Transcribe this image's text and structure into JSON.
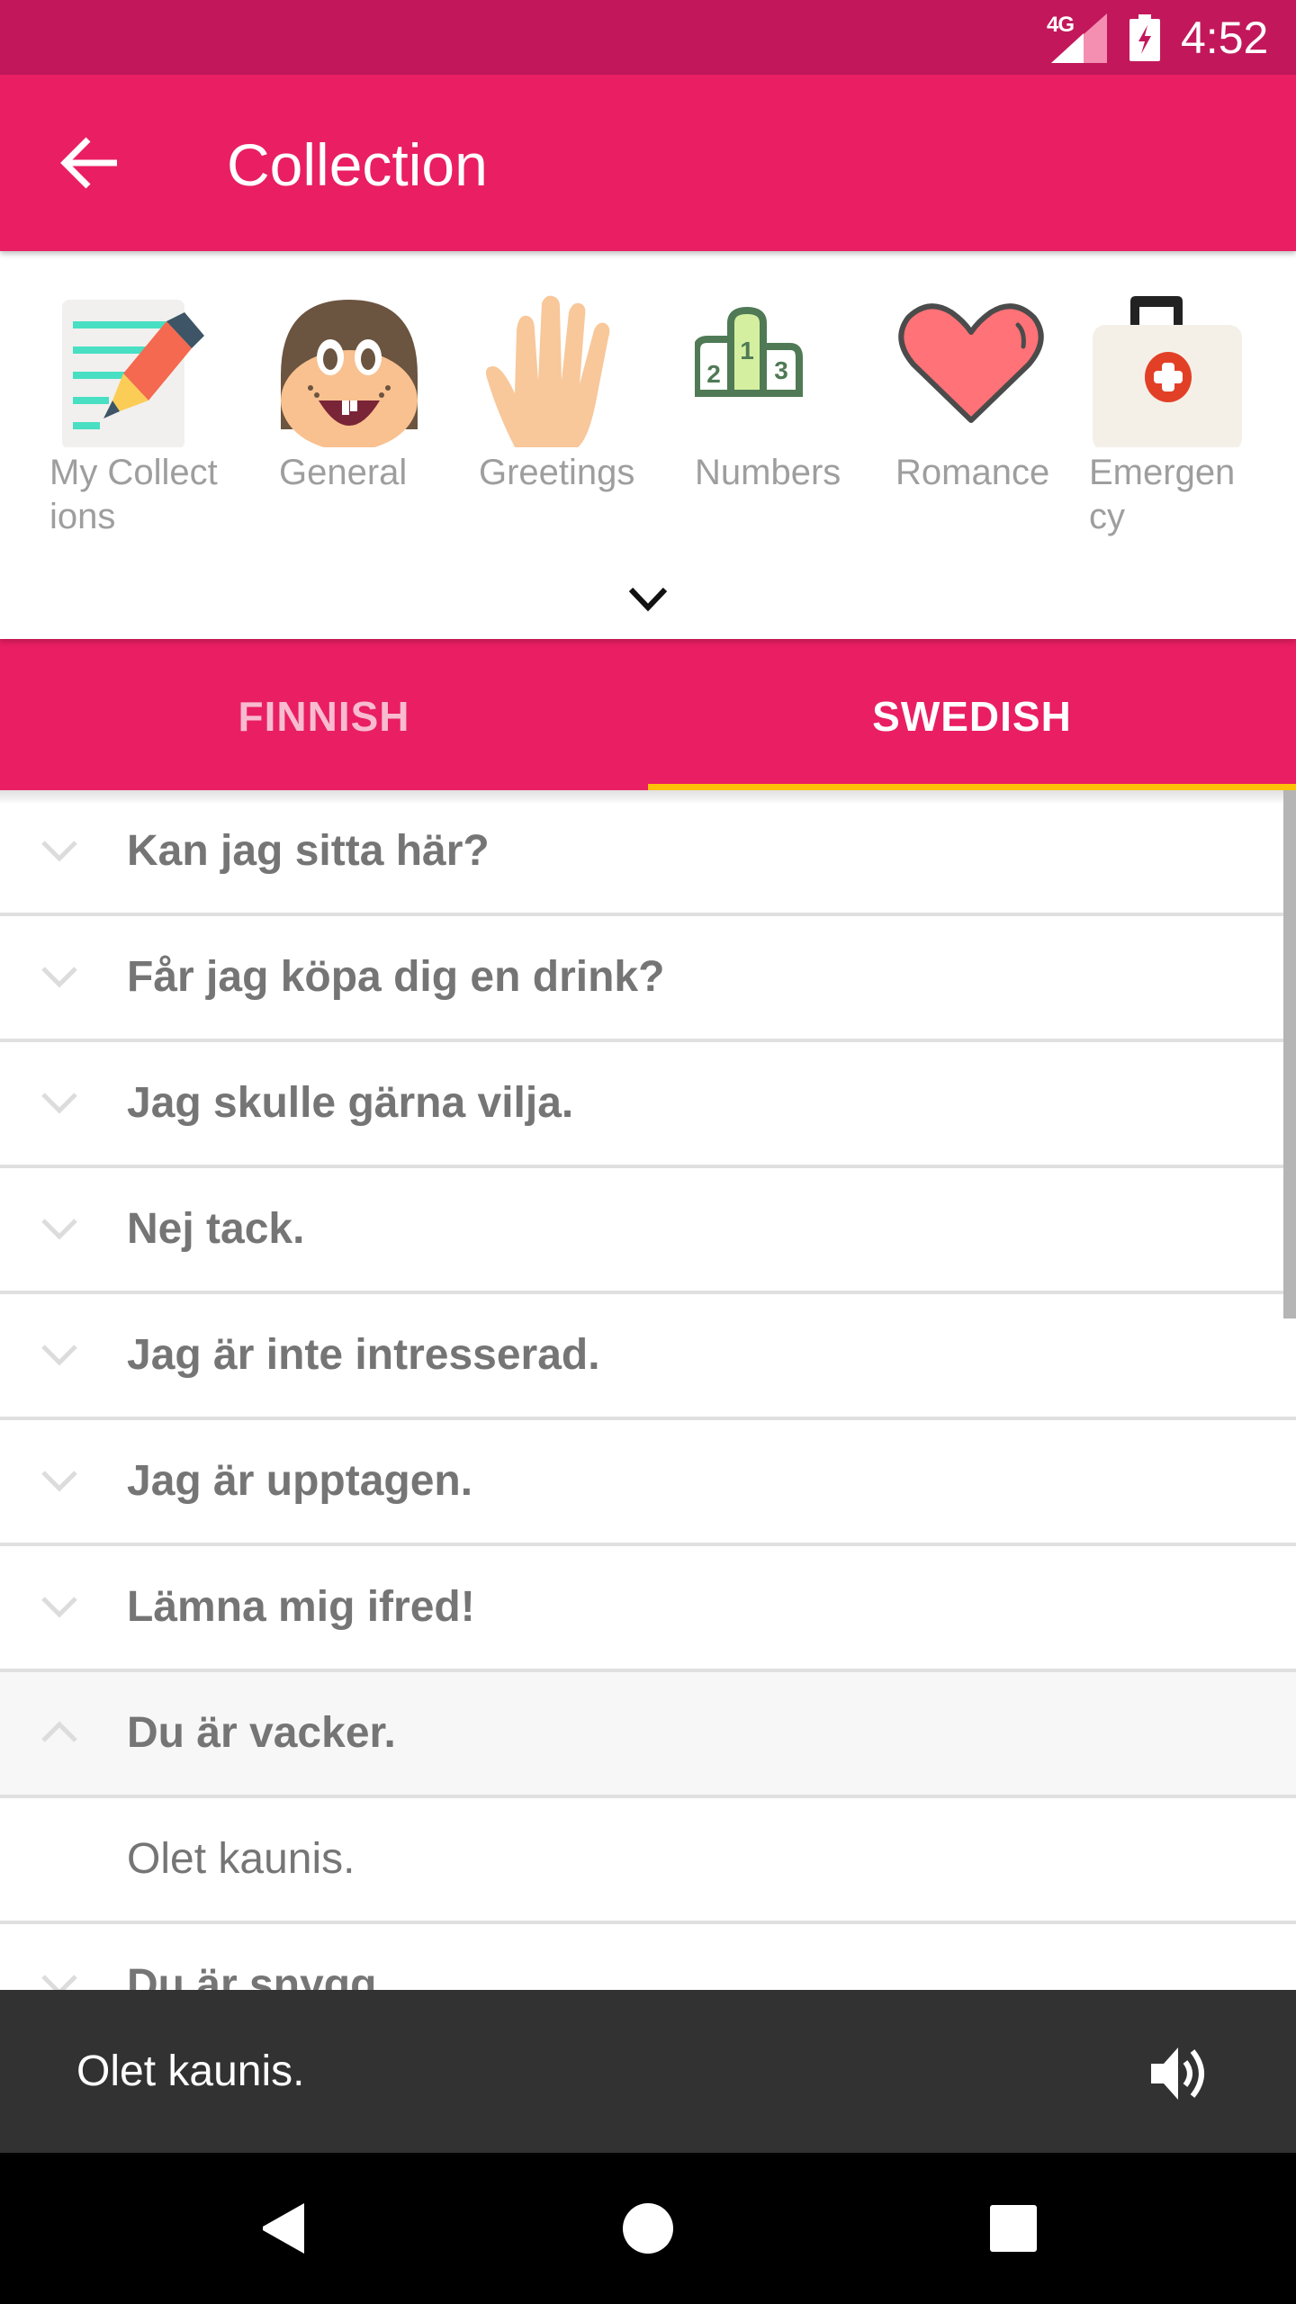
{
  "status_bar": {
    "network": "4G",
    "time": "4:52",
    "icons": [
      "signal-icon",
      "battery-charging-icon"
    ]
  },
  "app_bar": {
    "title": "Collection",
    "back_icon": "arrow-back-icon"
  },
  "categories": {
    "items": [
      {
        "label": "My Collect\nions",
        "icon": "notes-pencil-icon"
      },
      {
        "label": "General",
        "icon": "smiling-face-icon"
      },
      {
        "label": "Greetings",
        "icon": "waving-hand-icon"
      },
      {
        "label": "Numbers",
        "icon": "podium-icon"
      },
      {
        "label": "Romance",
        "icon": "heart-icon"
      },
      {
        "label": "Emergen\ncy",
        "icon": "first-aid-kit-icon"
      }
    ],
    "expand_icon": "chevron-down-icon"
  },
  "tabs": {
    "items": [
      {
        "label": "FINNISH",
        "selected": false
      },
      {
        "label": "SWEDISH",
        "selected": true
      }
    ]
  },
  "colors": {
    "primary": "#e91e63",
    "primary_dark": "#c2185b",
    "accent": "#ffc107",
    "text_secondary": "#757575",
    "snackbar": "#323232"
  },
  "phrases": {
    "items": [
      {
        "text": "Kan jag sitta här?",
        "expanded": false
      },
      {
        "text": "Får jag köpa dig en drink?",
        "expanded": false
      },
      {
        "text": "Jag skulle gärna vilja.",
        "expanded": false
      },
      {
        "text": "Nej tack.",
        "expanded": false
      },
      {
        "text": "Jag är inte intresserad.",
        "expanded": false
      },
      {
        "text": "Jag är upptagen.",
        "expanded": false
      },
      {
        "text": "Lämna mig ifred!",
        "expanded": false
      },
      {
        "text": "Du är vacker.",
        "expanded": true,
        "translation": "Olet kaunis."
      },
      {
        "text": "Du är snygg.",
        "expanded": false
      }
    ]
  },
  "snackbar": {
    "message": "Olet kaunis.",
    "action_icon": "speaker-icon"
  },
  "nav_bar": {
    "buttons": [
      "back-triangle-icon",
      "home-circle-icon",
      "recents-square-icon"
    ]
  }
}
